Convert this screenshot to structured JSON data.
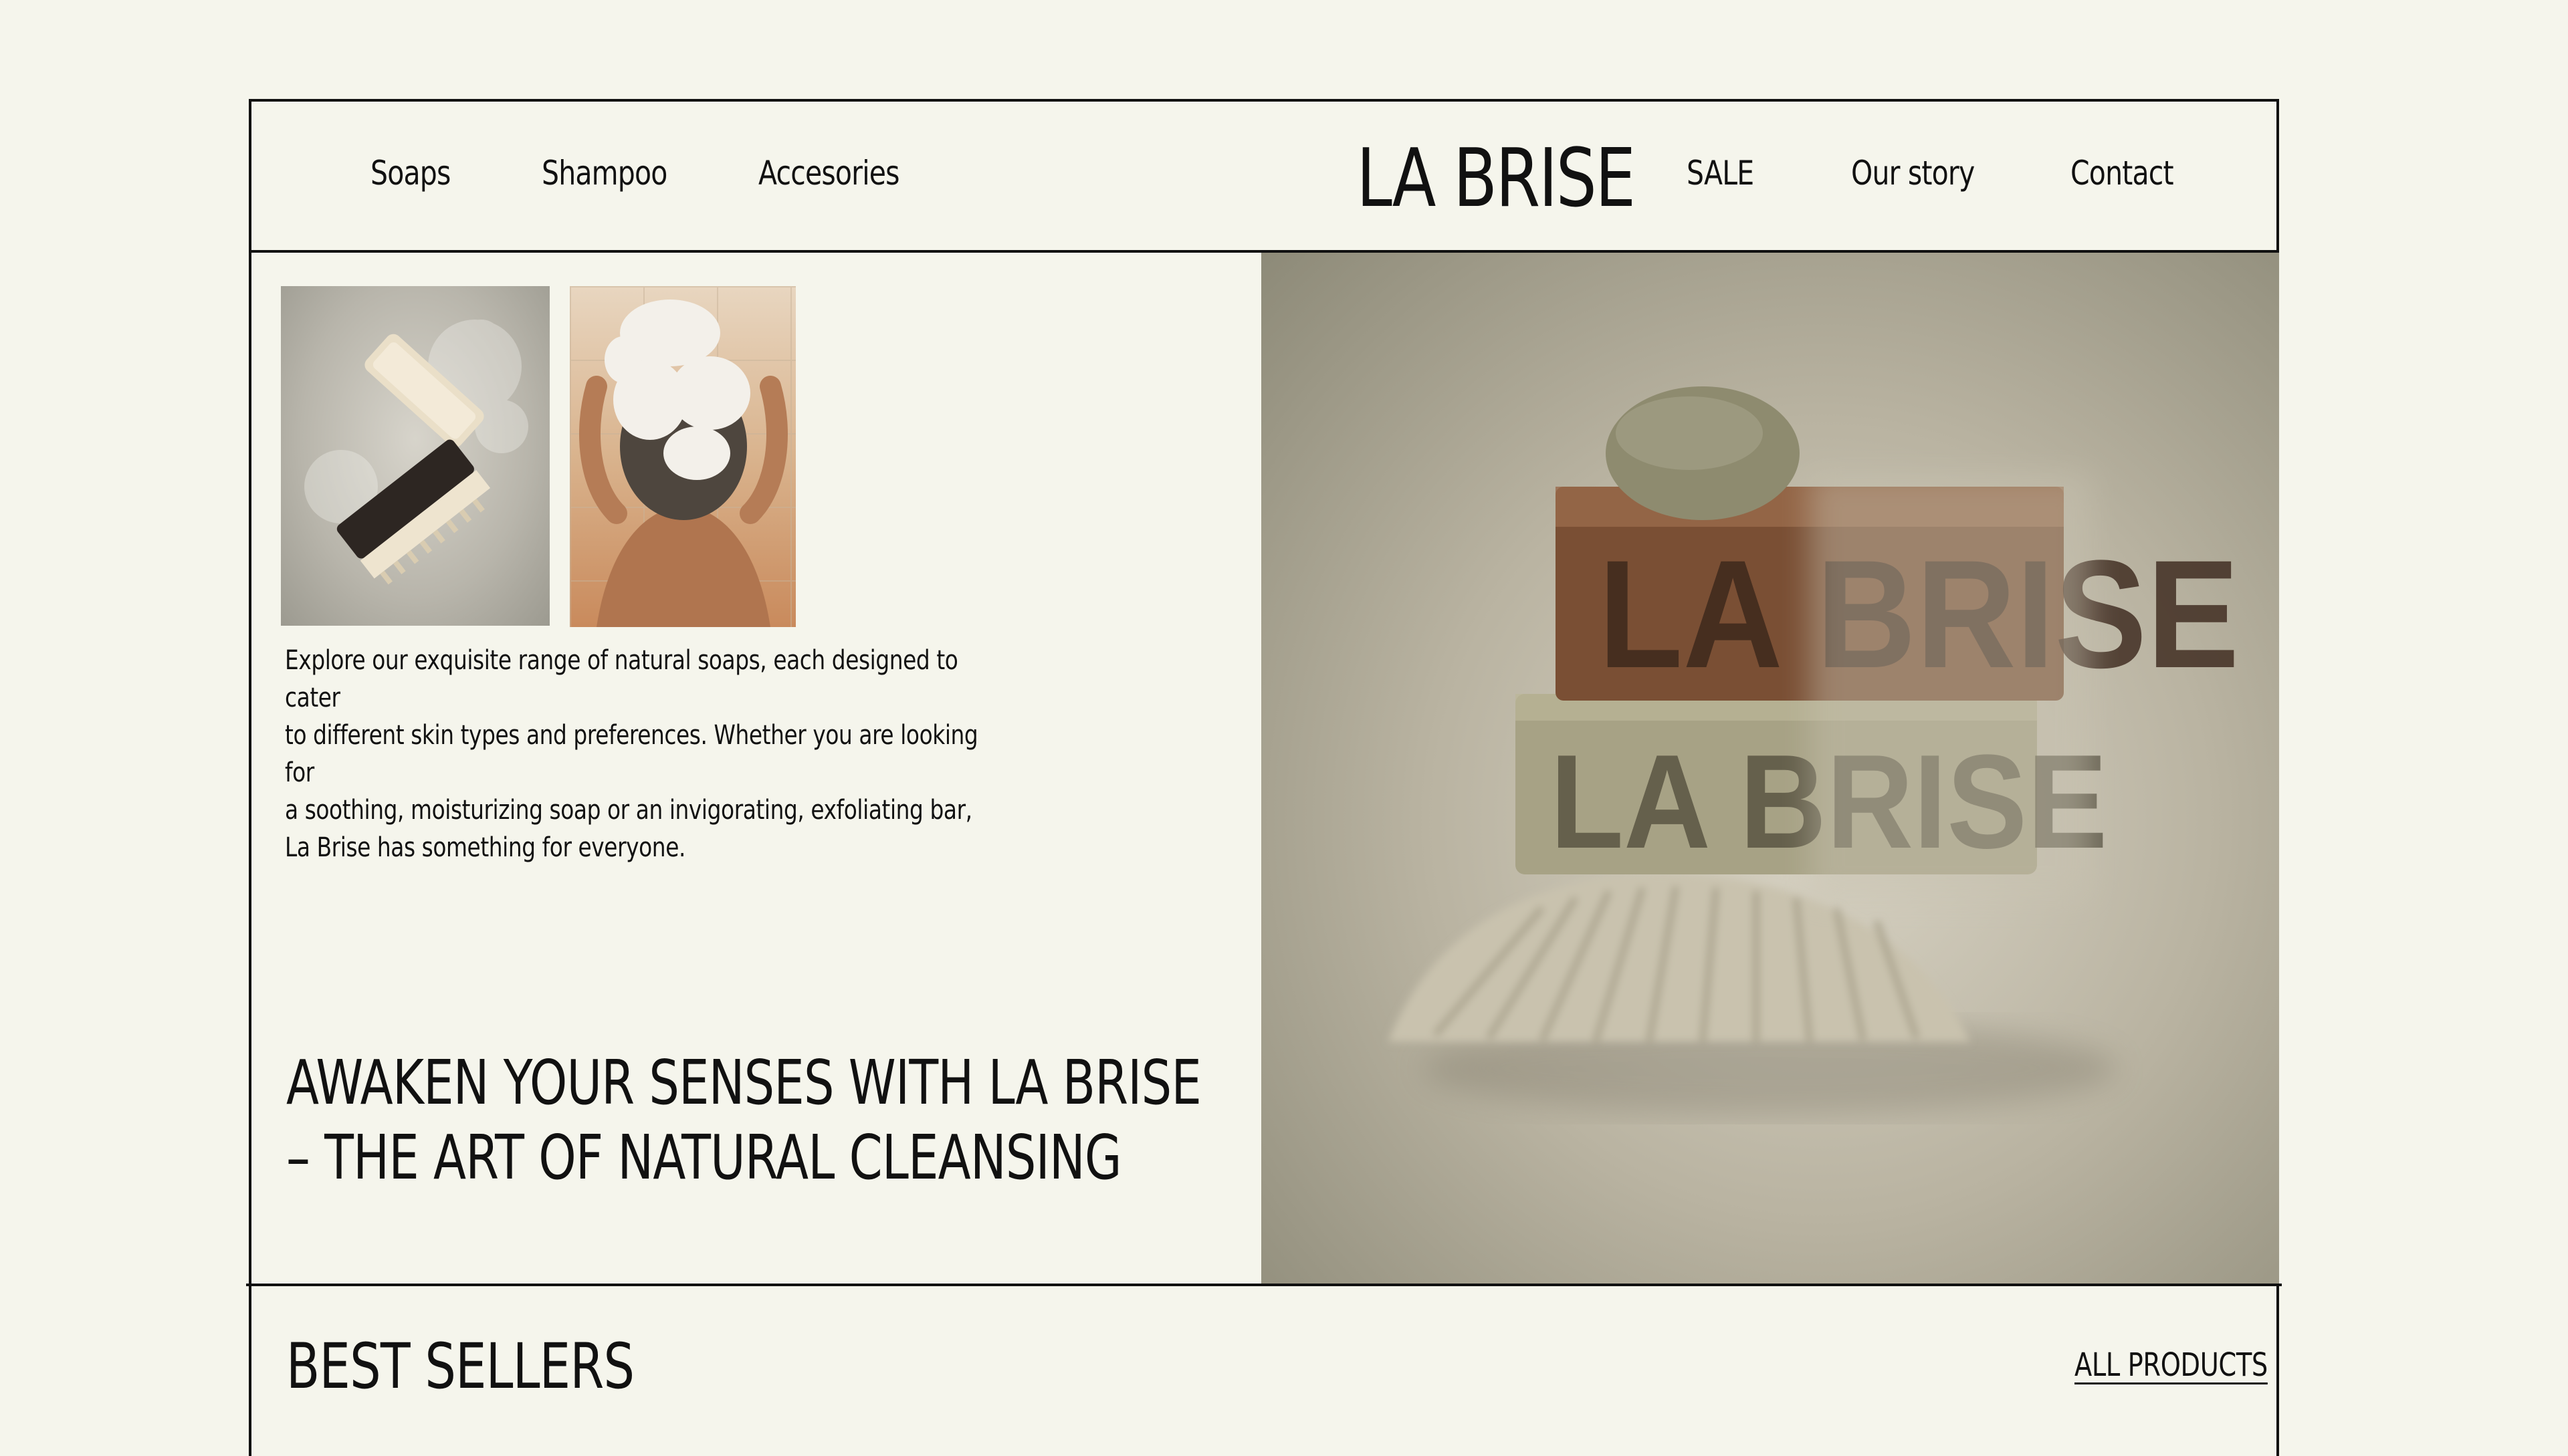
{
  "nav": {
    "left_links": [
      "Soaps",
      "Shampoo",
      "Accesories"
    ],
    "brand": "LA BRISE",
    "right_links": [
      "SALE",
      "Our story",
      "Contact"
    ]
  },
  "hero": {
    "intro_lines": [
      "Explore our exquisite range of natural soaps, each designed to cater",
      "to different skin types and preferences. Whether you are looking for",
      "a soothing, moisturizing soap or an invigorating, exfoliating bar,",
      "La Brise has something for everyone."
    ],
    "headline_lines": [
      "AWAKEN YOUR SENSES WITH LA BRISE",
      "– THE ART OF NATURAL CLEANSING"
    ],
    "image_stamp_text": "LA BRISE"
  },
  "best_sellers": {
    "title": "BEST SELLERS",
    "link_label": "ALL PRODUCTS"
  },
  "colors": {
    "background": "#f5f5ec",
    "text": "#111111",
    "accent_border": "#111111"
  }
}
